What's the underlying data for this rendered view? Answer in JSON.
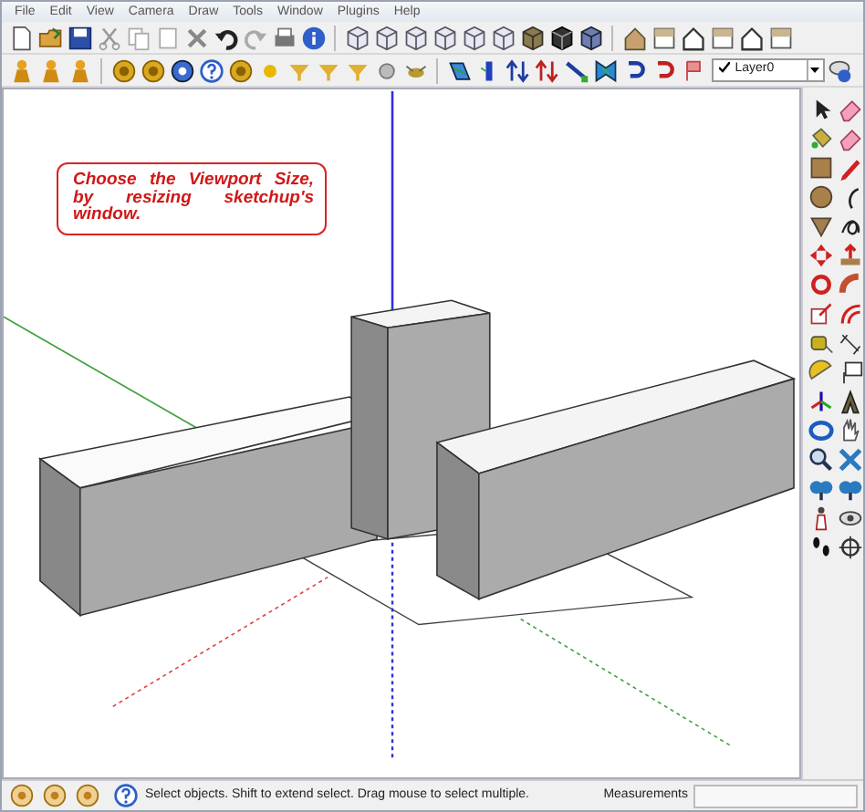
{
  "menu": [
    "File",
    "Edit",
    "View",
    "Camera",
    "Draw",
    "Tools",
    "Window",
    "Plugins",
    "Help"
  ],
  "layer_dropdown": {
    "checked": true,
    "value": "Layer0"
  },
  "viewport": {
    "note": "Choose the Viewport Size, by resizing sketchup's window."
  },
  "status_bar": {
    "hint": "Select objects. Shift to extend select. Drag mouse to select multiple.",
    "measurements_label": "Measurements"
  }
}
